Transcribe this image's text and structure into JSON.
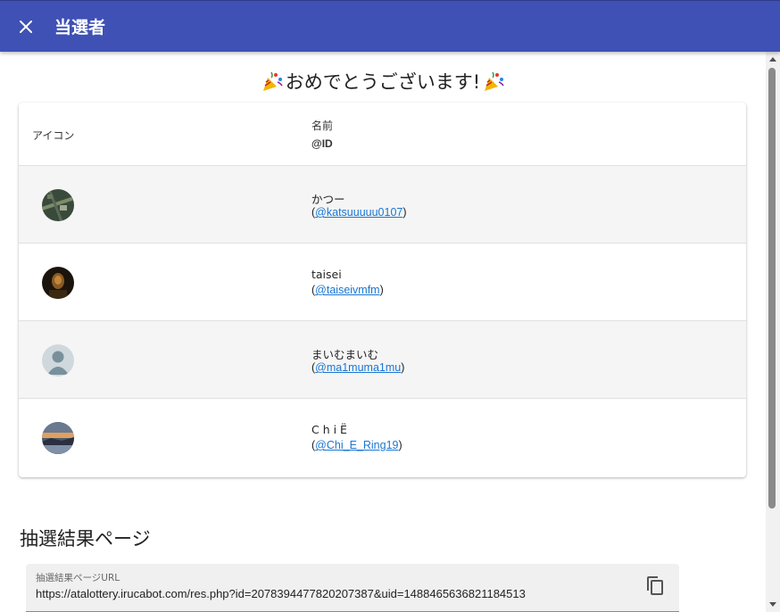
{
  "dialog": {
    "title": "当選者"
  },
  "congrats_text": "おめでとうございます!",
  "table": {
    "header_icon": "アイコン",
    "header_name": "名前",
    "header_id": "@ID",
    "rows": [
      {
        "name": "かつー",
        "id": "@katsuuuuu0107",
        "avatar": "aerial-photo-avatar",
        "avatar_colors": [
          "#3a4a3a",
          "#7c8c6c"
        ]
      },
      {
        "name": "taisei",
        "id": "@taiseivmfm",
        "avatar": "dark-portrait-avatar",
        "avatar_colors": [
          "#1b140c",
          "#c0863a"
        ]
      },
      {
        "name": "まいむまいむ",
        "id": "@ma1muma1mu",
        "avatar": "default-user-avatar",
        "avatar_colors": [
          "#cfd8dc",
          "#78909c"
        ]
      },
      {
        "name": "C h i Ë",
        "id": "@Chi_E_Ring19",
        "avatar": "sunset-landscape-avatar",
        "avatar_colors": [
          "#4a5a70",
          "#e0a060"
        ]
      }
    ]
  },
  "result_page": {
    "section_title": "抽選結果ページ",
    "url_label": "抽選結果ページURL",
    "url_value": "https://atalottery.irucabot.com/res.php?id=2078394477820207387&uid=1488465636821184513"
  },
  "icons": {
    "close": "close-icon",
    "copy": "copy-icon",
    "party": "party-popper-icon"
  },
  "colors": {
    "appbar": "#3f51b5",
    "link": "#1976d2",
    "row_shade": "#f5f5f5"
  }
}
